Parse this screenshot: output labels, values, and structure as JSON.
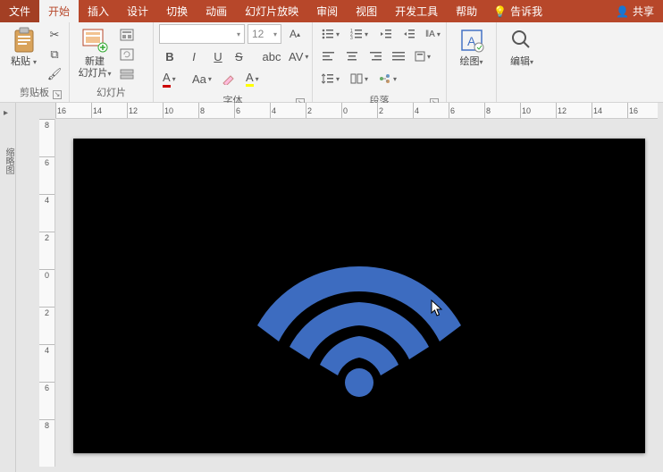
{
  "tabs": {
    "file": "文件",
    "home": "开始",
    "insert": "插入",
    "design": "设计",
    "transition": "切换",
    "animation": "动画",
    "slideshow": "幻灯片放映",
    "review": "审阅",
    "view": "视图",
    "devtools": "开发工具",
    "help": "帮助",
    "tellme": "告诉我",
    "share": "共享"
  },
  "ribbon": {
    "clipboard": {
      "label": "剪贴板",
      "paste": "粘贴"
    },
    "slides": {
      "label": "幻灯片",
      "new": "新建\n幻灯片"
    },
    "font": {
      "label": "字体",
      "name_placeholder": "",
      "size_value": "12",
      "bold": "B",
      "italic": "I",
      "underline": "U",
      "strike": "S",
      "clear": "A",
      "aa": "Aa"
    },
    "paragraph": {
      "label": "段落"
    },
    "drawing": {
      "label": "绘图"
    },
    "editing": {
      "label": "编辑"
    }
  },
  "sidebar": {
    "thumbnails_label": "缩略图"
  },
  "ruler": {
    "h": [
      "16",
      "14",
      "12",
      "10",
      "8",
      "6",
      "4",
      "2",
      "0",
      "2",
      "4",
      "6",
      "8",
      "10",
      "12",
      "14",
      "16"
    ],
    "v": [
      "8",
      "6",
      "4",
      "2",
      "0",
      "2",
      "4",
      "6",
      "8"
    ]
  },
  "slide": {
    "shape_color": "#3d6cc0"
  }
}
